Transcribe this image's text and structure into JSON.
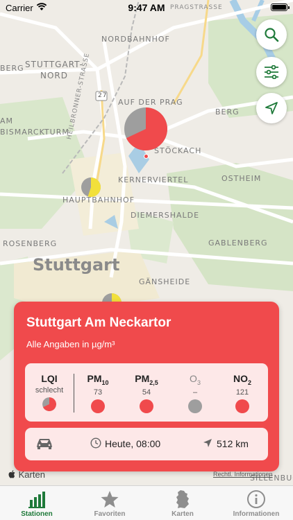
{
  "status_bar": {
    "carrier": "Carrier",
    "time": "9:47 AM"
  },
  "map": {
    "city_label": "Stuttgart",
    "district_labels": [
      "NORDBAHNHOF",
      "STUTTGART-",
      "NORD",
      "BERG",
      "AUF DER PRAG",
      "BERG",
      "AM",
      "BISMARCKTURM",
      "STÖCKACH",
      "KERNERVIERTEL",
      "OSTHEIM",
      "HAUPTBAHNHOF",
      "DIEMERSHALDE",
      "ROSENBERG",
      "GABLENBERG",
      "GÄNSHEIDE",
      "SILLENBUC"
    ],
    "street_labels": [
      "PRAGSTRASSE",
      "HEILBRONNER-STRASSE"
    ],
    "road_shield": "27",
    "markers": [
      {
        "name": "Stuttgart Am Neckartor",
        "lqi_level": "schlecht",
        "fill": 0.68,
        "color": "#f04a4c"
      },
      {
        "name": "Hauptbahnhof station",
        "fill": 0.55,
        "color": "#f2e03b"
      },
      {
        "name": "south station",
        "fill": 0.5,
        "color": "#f2e03b"
      }
    ]
  },
  "buttons": {
    "search_icon": "search-icon",
    "filter_icon": "sliders-icon",
    "locate_icon": "location-arrow-icon"
  },
  "card": {
    "title": "Stuttgart Am Neckartor",
    "units": "Alle Angaben in µg/m³",
    "lqi": {
      "label": "LQI",
      "value": "schlecht",
      "level_fraction": 0.68
    },
    "pollutants": [
      {
        "label": "PM",
        "sub": "10",
        "value": "73",
        "color": "#f04a4c"
      },
      {
        "label": "PM",
        "sub": "2,5",
        "value": "54",
        "color": "#f04a4c"
      },
      {
        "label": "O",
        "sub": "3",
        "value": "–",
        "color": "#9e9e9e"
      },
      {
        "label": "NO",
        "sub": "2",
        "value": "121",
        "color": "#f04a4c"
      }
    ],
    "time": "Heute, 08:00",
    "distance": "512 km"
  },
  "map_attribution": {
    "apple_maps": "Karten",
    "legal": "Rechtl. Informationen"
  },
  "tabs": [
    {
      "label": "Stationen",
      "icon": "bar-chart-icon",
      "active": true
    },
    {
      "label": "Favoriten",
      "icon": "star-icon",
      "active": false
    },
    {
      "label": "Karten",
      "icon": "germany-map-icon",
      "active": false
    },
    {
      "label": "Informationen",
      "icon": "info-icon",
      "active": false
    }
  ],
  "colors": {
    "accent_green": "#1f7a3a",
    "bad_red": "#f04a4c",
    "moderate_yellow": "#f2e03b"
  }
}
